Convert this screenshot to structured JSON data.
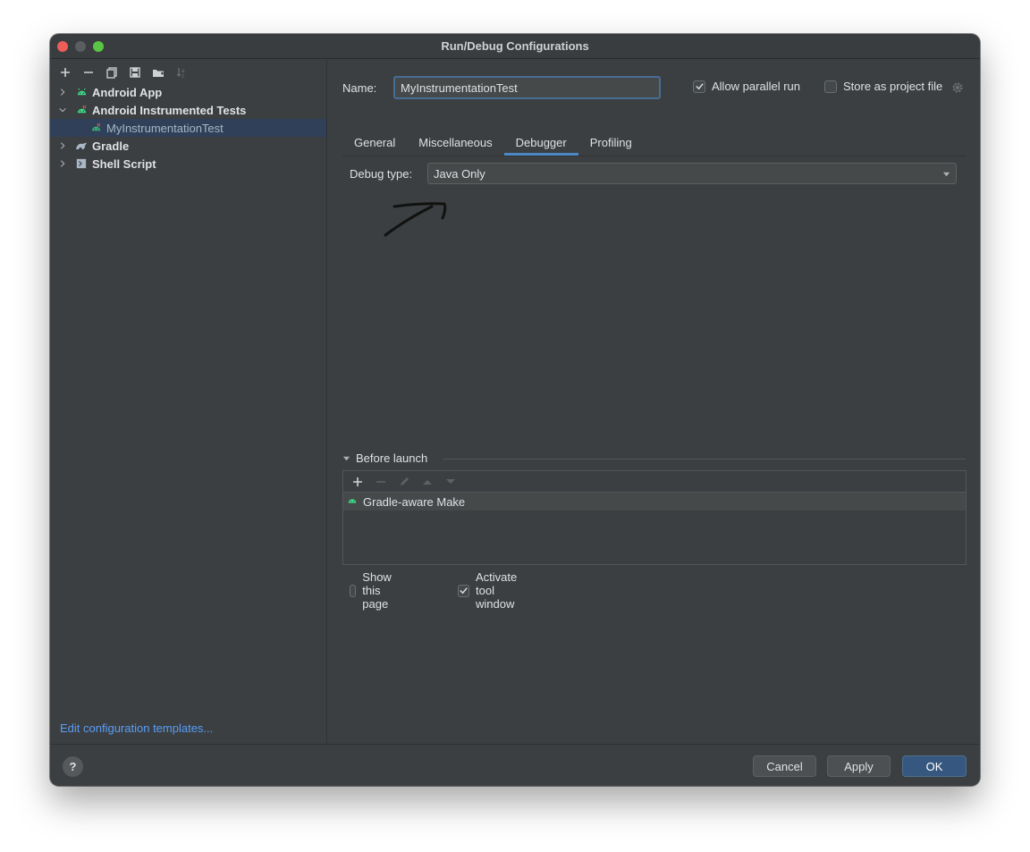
{
  "window": {
    "title": "Run/Debug Configurations"
  },
  "toolbar": {
    "icons": [
      "add-icon",
      "remove-icon",
      "copy-icon",
      "save-icon",
      "folder-icon",
      "sort-icon"
    ]
  },
  "tree": {
    "android_app": "Android App",
    "android_tests": "Android Instrumented Tests",
    "my_test": "MyInstrumentationTest",
    "gradle": "Gradle",
    "shell": "Shell Script"
  },
  "sidebar": {
    "templates_link": "Edit configuration templates..."
  },
  "form": {
    "name_label": "Name:",
    "name_value": "MyInstrumentationTest",
    "allow_parallel": "Allow parallel run",
    "store_project": "Store as project file"
  },
  "tabs": {
    "general": "General",
    "misc": "Miscellaneous",
    "debugger": "Debugger",
    "profiling": "Profiling"
  },
  "debugger": {
    "debug_type_label": "Debug type:",
    "debug_type_value": "Java Only"
  },
  "before_launch": {
    "title": "Before launch",
    "item": "Gradle-aware Make",
    "show_page": "Show this page",
    "activate_tool": "Activate tool window"
  },
  "footer": {
    "help": "?",
    "cancel": "Cancel",
    "apply": "Apply",
    "ok": "OK"
  },
  "colors": {
    "accent": "#4a88c7",
    "ok_button": "#365880",
    "link": "#589df6",
    "android_green": "#3ddc84"
  }
}
